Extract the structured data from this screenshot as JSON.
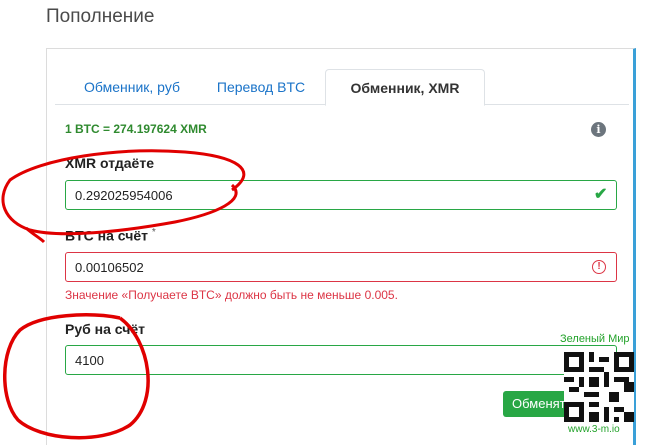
{
  "page_title": "Пополнение",
  "tabs": [
    {
      "label": "Обменник, руб",
      "active": false
    },
    {
      "label": "Перевод BTC",
      "active": false
    },
    {
      "label": "Обменник, XMR",
      "active": true
    }
  ],
  "rate_text": "1 BTC = 274.197624 XMR",
  "info_icon": "info-icon",
  "fields": {
    "xmr_give": {
      "label": "XMR отдаёте",
      "value": "0.292025954006",
      "state": "valid"
    },
    "btc_receive": {
      "label": "BTC на счёт",
      "required_mark": "*",
      "value": "0.00106502",
      "state": "invalid",
      "error": "Значение «Получаете BTC» должно быть не меньше 0.005."
    },
    "rub_account": {
      "label": "Руб на счёт",
      "value": "4100"
    }
  },
  "submit_label": "Обменять",
  "watermark": {
    "title": "Зеленый Мир",
    "url": "www.3-m.io"
  },
  "colors": {
    "accent": "#1a73c8",
    "success": "#28a745",
    "danger": "#dc3545",
    "marker": "#e00000"
  }
}
